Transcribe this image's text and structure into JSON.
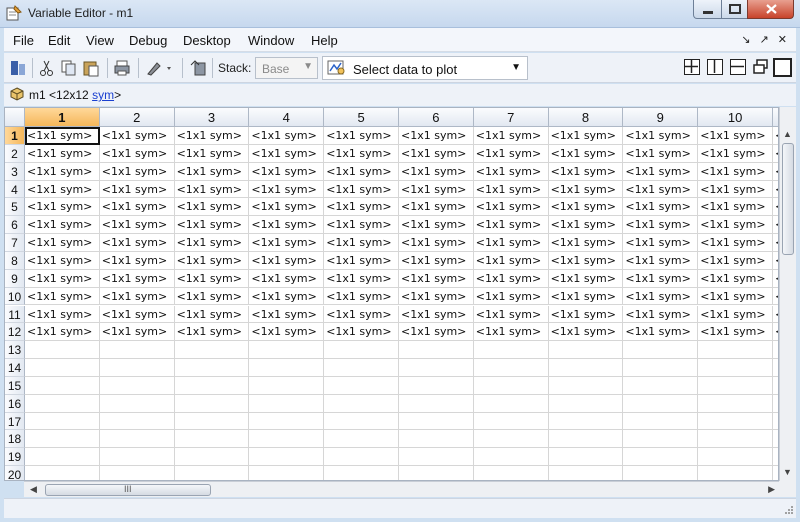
{
  "window": {
    "title": "Variable Editor - m1"
  },
  "menubar": {
    "items": [
      "File",
      "Edit",
      "View",
      "Debug",
      "Desktop",
      "Window",
      "Help"
    ],
    "dock_icons": "↘ ↗ ✕"
  },
  "toolbar": {
    "stack_label": "Stack:",
    "stack_value": "Base",
    "plot_select_label": "Select data to plot"
  },
  "variable": {
    "name": "m1",
    "size_prefix": "<12x12",
    "class_link": "sym",
    "size_suffix": ">"
  },
  "grid": {
    "column_headers": [
      "1",
      "2",
      "3",
      "4",
      "5",
      "6",
      "7",
      "8",
      "9",
      "10"
    ],
    "row_headers": [
      "1",
      "2",
      "3",
      "4",
      "5",
      "6",
      "7",
      "8",
      "9",
      "10",
      "11",
      "12",
      "13",
      "14",
      "15",
      "16",
      "17",
      "18",
      "19",
      "20"
    ],
    "filled_rows": 12,
    "cell_text": "<1x1 sym>",
    "partial_cell_text": "<",
    "active_cell": "1,1"
  }
}
